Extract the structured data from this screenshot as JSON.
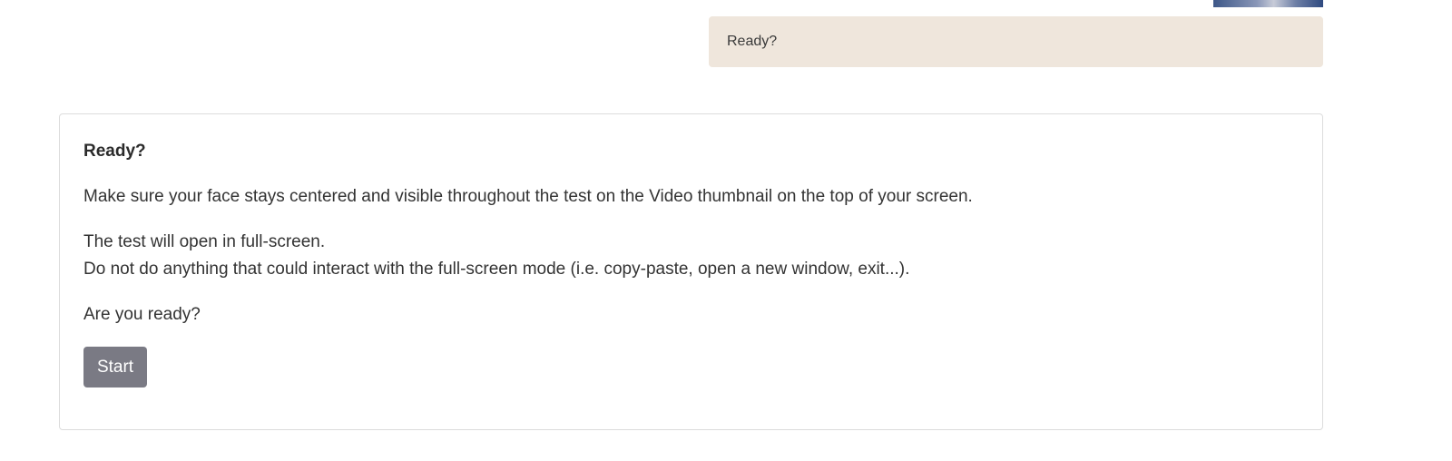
{
  "status": {
    "label": "Ready?"
  },
  "card": {
    "title": "Ready?",
    "instruction": "Make sure your face stays centered and visible throughout the test on the Video thumbnail on the top of your screen.",
    "fullscreen_note": "The test will open in full-screen.",
    "warning": "Do not do anything that could interact with the full-screen mode (i.e. copy-paste, open a new window, exit...).",
    "question": "Are you ready?",
    "start_label": "Start"
  },
  "colors": {
    "status_bubble": "#efe6dc",
    "start_button": "#7a7a84",
    "card_border": "#dcdcdc"
  }
}
